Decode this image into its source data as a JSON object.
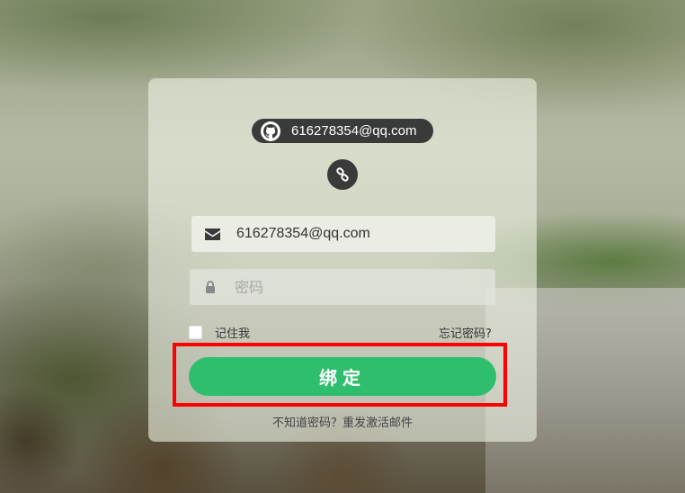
{
  "github_badge": {
    "icon": "github-icon",
    "email": "616278354@qq.com"
  },
  "link_icon": "link-icon",
  "form": {
    "email": {
      "icon": "envelope-icon",
      "value": "616278354@qq.com"
    },
    "password": {
      "icon": "lock-icon",
      "placeholder": "密码"
    },
    "remember_label": "记住我",
    "forgot_label": "忘记密码?",
    "submit_label": "绑定",
    "resend_text": "不知道密码？重发激活邮件"
  },
  "colors": {
    "submit_bg": "#2ebe6e",
    "badge_bg": "#3a3a3a",
    "highlight": "#ff0000"
  }
}
